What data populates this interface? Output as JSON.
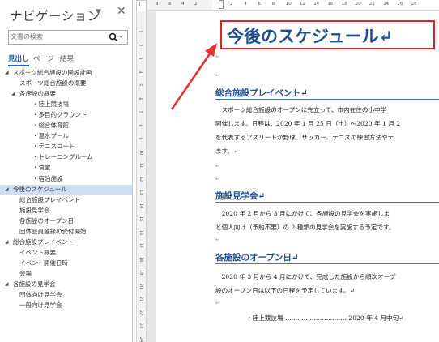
{
  "nav": {
    "title": "ナビゲーション",
    "dropdown_glyph": "▼",
    "close_glyph": "✕",
    "search_placeholder": "文書の検索",
    "tabs": [
      {
        "label": "見出し",
        "selected": true
      },
      {
        "label": "ページ",
        "selected": false
      },
      {
        "label": "結果",
        "selected": false
      }
    ],
    "outline": [
      {
        "label": "スポーツ総合施設の開設計画",
        "level": 0,
        "toggle": "◢",
        "selected": false
      },
      {
        "label": "スポーツ総合施設の概要",
        "level": 1,
        "toggle": "",
        "selected": false
      },
      {
        "label": "各施設の概要",
        "level": 1,
        "toggle": "◢",
        "selected": false
      },
      {
        "label": "・陸上競技場",
        "level": 2,
        "toggle": "",
        "selected": false
      },
      {
        "label": "・多目的グラウンド",
        "level": 2,
        "toggle": "",
        "selected": false
      },
      {
        "label": "・総合体育館",
        "level": 2,
        "toggle": "",
        "selected": false
      },
      {
        "label": "・温水プール",
        "level": 2,
        "toggle": "",
        "selected": false
      },
      {
        "label": "・テニスコート",
        "level": 2,
        "toggle": "",
        "selected": false
      },
      {
        "label": "・トレーニングルーム",
        "level": 2,
        "toggle": "",
        "selected": false
      },
      {
        "label": "・食堂",
        "level": 2,
        "toggle": "",
        "selected": false
      },
      {
        "label": "・宿泊施設",
        "level": 2,
        "toggle": "",
        "selected": false
      },
      {
        "label": "今後のスケジュール",
        "level": 0,
        "toggle": "◢",
        "selected": true
      },
      {
        "label": "総合施設プレイベント",
        "level": 1,
        "toggle": "",
        "selected": false
      },
      {
        "label": "施設見学会",
        "level": 1,
        "toggle": "",
        "selected": false
      },
      {
        "label": "各施設のオープン日",
        "level": 1,
        "toggle": "",
        "selected": false
      },
      {
        "label": "団体会員登録の受付開始",
        "level": 1,
        "toggle": "",
        "selected": false
      },
      {
        "label": "総合施設プレイベント",
        "level": 0,
        "toggle": "◢",
        "selected": false
      },
      {
        "label": "イベント概要",
        "level": 1,
        "toggle": "",
        "selected": false
      },
      {
        "label": "イベント開催日時",
        "level": 1,
        "toggle": "",
        "selected": false
      },
      {
        "label": "会場",
        "level": 1,
        "toggle": "",
        "selected": false
      },
      {
        "label": "各施設の見学会",
        "level": 0,
        "toggle": "◢",
        "selected": false
      },
      {
        "label": "団体向け見学会",
        "level": 1,
        "toggle": "",
        "selected": false
      },
      {
        "label": "一般向け見学会",
        "level": 1,
        "toggle": "",
        "selected": false
      }
    ]
  },
  "ruler": {
    "corner": "L",
    "h_left": [
      "8",
      "6",
      "4",
      "2"
    ],
    "h_right": [
      "2",
      "4",
      "6",
      "8",
      "10",
      "12",
      "14",
      "16",
      "18",
      "20",
      "22",
      "24",
      "26",
      "28"
    ],
    "v_ticks": [
      "1",
      "2",
      "3",
      "4",
      "5",
      "6",
      "7",
      "8",
      "9",
      "10",
      "11",
      "12",
      "13",
      "14",
      "15",
      "16",
      "17",
      "18",
      "19",
      "20",
      "21",
      "22",
      "23",
      "24"
    ]
  },
  "document": {
    "title": "今後のスケジュール↵",
    "para_mark": "↵",
    "sections": [
      {
        "heading": "総合施設プレイベント↵",
        "lines": [
          "　スポーツ総合施設のオープンに先立って、市内在住の小中学",
          "開催します。日程は、2020 年 1 月 25 日（土）～2020 年 1 月 2",
          "を代表するアスリートが野球、サッカー、テニスの練習方法やテ",
          "ます。↵"
        ]
      },
      {
        "heading": "施設見学会↵",
        "lines": [
          "　2020 年 2 月から 3 月にかけて、各施設の見学会を実施しま",
          "と個人向け（予約不要）の 2 種類の見学会を実施する予定です。"
        ]
      },
      {
        "heading": "各施設のオープン日↵",
        "lines": [
          "　2020 年 3 月から 4 月にかけて、完成した施設から順次オープ",
          "設のオープン日は以下の日程を予定しています。↵"
        ]
      }
    ],
    "list": [
      "・陸上競技場 ………………………… 2020 年 4 月中旬↵"
    ]
  },
  "colors": {
    "heading": "#1f4f8f",
    "highlight_box": "#e02020",
    "nav_selected": "#cfdff3",
    "arrow": "#e83030"
  }
}
